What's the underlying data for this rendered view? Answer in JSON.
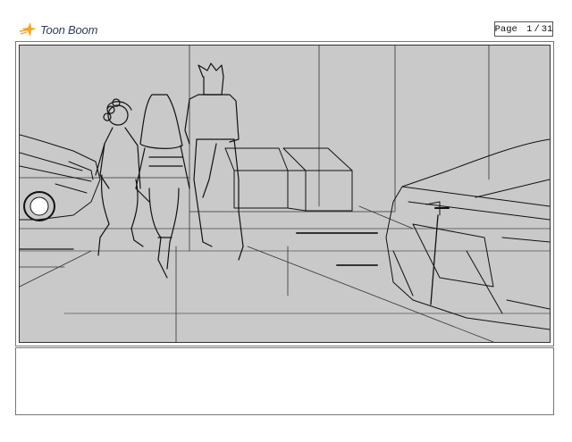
{
  "app": {
    "logo_text": "Toon Boom",
    "logo_icon": "toon-boom-star-icon"
  },
  "page": {
    "label": "Page",
    "current": "1",
    "total": "31"
  },
  "panel": {
    "scene": "storyboard-sketch-parking-garage"
  },
  "caption": {
    "text": ""
  },
  "colors": {
    "panel_bg": "#c9c9c9",
    "logo_orange": "#f5a623",
    "logo_text": "#2c3e5a",
    "line": "#111111"
  }
}
